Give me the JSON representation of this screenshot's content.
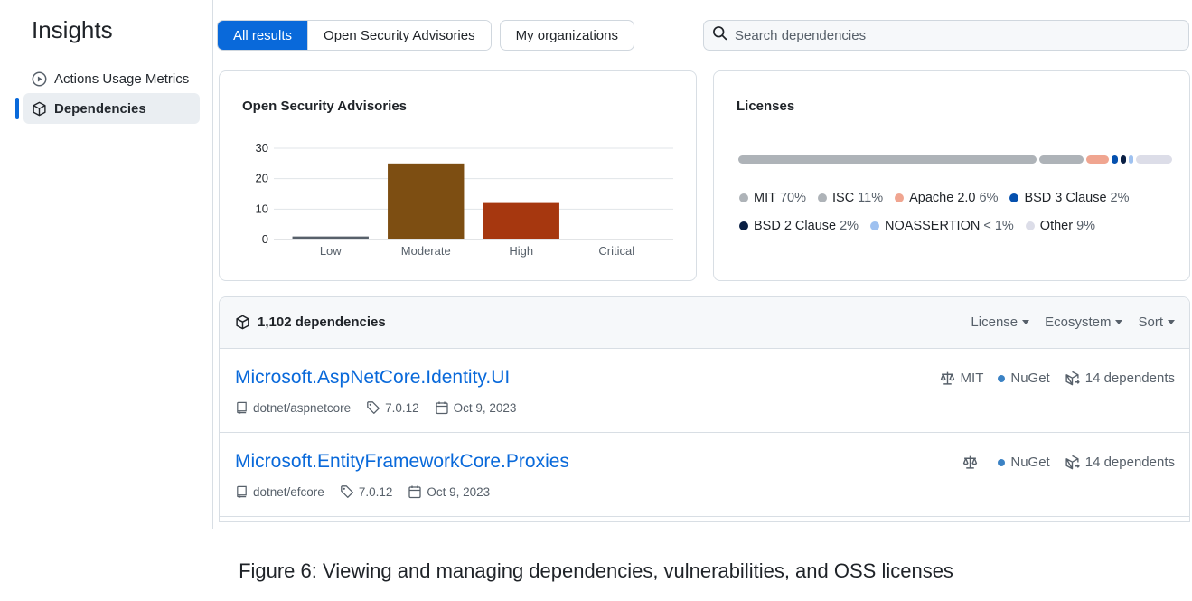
{
  "sidebar": {
    "title": "Insights",
    "items": [
      {
        "label": "Actions Usage Metrics",
        "icon": "play-circle-icon",
        "active": false
      },
      {
        "label": "Dependencies",
        "icon": "package-icon",
        "active": true
      }
    ]
  },
  "tabs": {
    "all_results": "All results",
    "open_security_advisories": "Open Security Advisories",
    "my_organizations": "My organizations"
  },
  "search": {
    "placeholder": "Search dependencies",
    "value": ""
  },
  "advisories_card": {
    "title": "Open Security Advisories"
  },
  "licenses_card": {
    "title": "Licenses"
  },
  "chart_data": {
    "type": "bar",
    "title": "Open Security Advisories",
    "xlabel": "",
    "ylabel": "",
    "categories": [
      "Low",
      "Moderate",
      "High",
      "Critical"
    ],
    "values": [
      1,
      25,
      12,
      0
    ],
    "colors": [
      "#57606a",
      "#7d4e12",
      "#a6370f",
      "#6e7781"
    ],
    "y_ticks": [
      0,
      10,
      20,
      30
    ],
    "ylim": [
      0,
      30
    ],
    "grid": true
  },
  "licenses": [
    {
      "name": "MIT",
      "pct": "70%",
      "value": 70,
      "color": "#aeb3b8"
    },
    {
      "name": "ISC",
      "pct": "11%",
      "value": 11,
      "color": "#aeb3b8"
    },
    {
      "name": "Apache 2.0",
      "pct": "6%",
      "value": 6,
      "color": "#f0a590"
    },
    {
      "name": "BSD 3 Clause",
      "pct": "2%",
      "value": 2,
      "color": "#0550ae"
    },
    {
      "name": "BSD 2 Clause",
      "pct": "2%",
      "value": 2,
      "color": "#0a1f44"
    },
    {
      "name": "NOASSERTION",
      "pct": "< 1%",
      "value": 1,
      "color": "#9ec1f0"
    },
    {
      "name": "Other",
      "pct": "9%",
      "value": 9,
      "color": "#dcdde8"
    }
  ],
  "dependencies": {
    "count_label": "1,102 dependencies",
    "filters": {
      "license": "License",
      "ecosystem": "Ecosystem",
      "sort": "Sort"
    },
    "rows": [
      {
        "name": "Microsoft.AspNetCore.Identity.UI",
        "repo": "dotnet/aspnetcore",
        "version": "7.0.12",
        "date": "Oct 9, 2023",
        "license": "MIT",
        "ecosystem": "NuGet",
        "dependents": "14 dependents"
      },
      {
        "name": "Microsoft.EntityFrameworkCore.Proxies",
        "repo": "dotnet/efcore",
        "version": "7.0.12",
        "date": "Oct 9, 2023",
        "license": "",
        "ecosystem": "NuGet",
        "dependents": "14 dependents"
      }
    ]
  },
  "caption": "Figure 6: Viewing and managing dependencies, vulnerabilities, and OSS licenses"
}
